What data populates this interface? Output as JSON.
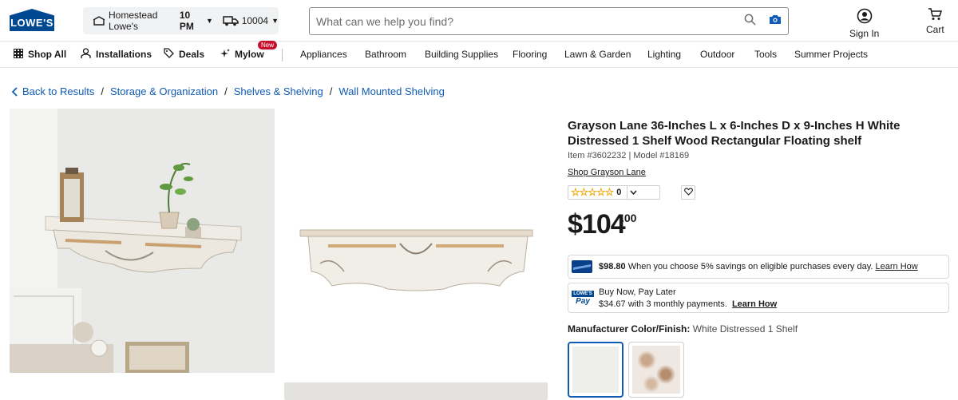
{
  "header": {
    "logo_text": "LOWE'S",
    "store_prefix": "Homestead Lowe's",
    "store_hours": "10 PM",
    "zip": "10004",
    "search_placeholder": "What can we help you find?",
    "sign_in": "Sign In",
    "cart": "Cart"
  },
  "nav": {
    "shop_all": "Shop All",
    "installations": "Installations",
    "deals": "Deals",
    "mylow": "Mylow",
    "mylow_badge": "New",
    "categories": [
      "Appliances",
      "Bathroom",
      "Building Supplies",
      "Flooring",
      "Lawn & Garden",
      "Lighting",
      "Outdoor",
      "Tools",
      "Summer Projects"
    ]
  },
  "breadcrumb": {
    "back": "Back to Results",
    "items": [
      "Storage & Organization",
      "Shelves & Shelving",
      "Wall Mounted Shelving"
    ]
  },
  "product": {
    "title": "Grayson Lane 36-Inches L x 6-Inches D x 9-Inches H White Distressed 1 Shelf Wood Rectangular Floating shelf",
    "item_line": "Item #3602232 | Model #18169",
    "shop_link": "Shop Grayson Lane",
    "rating_count": "0",
    "price_dollars": "$104",
    "price_cents": ".00",
    "card_offer_amount": "$98.80",
    "card_offer_text": "When you choose 5% savings on eligible purchases every day.",
    "learn_how": "Learn How",
    "pay_title": "Buy Now, Pay Later",
    "pay_detail": "$34.67 with 3 monthly payments.",
    "pay_logo_top": "LOWE'S",
    "pay_logo_bottom": "Pay",
    "color_label": "Manufacturer Color/Finish:",
    "color_value": "White Distressed 1 Shelf"
  },
  "colors": {
    "brand_blue": "#004990",
    "link_blue": "#0f5bb5",
    "badge_red": "#c8102e"
  }
}
